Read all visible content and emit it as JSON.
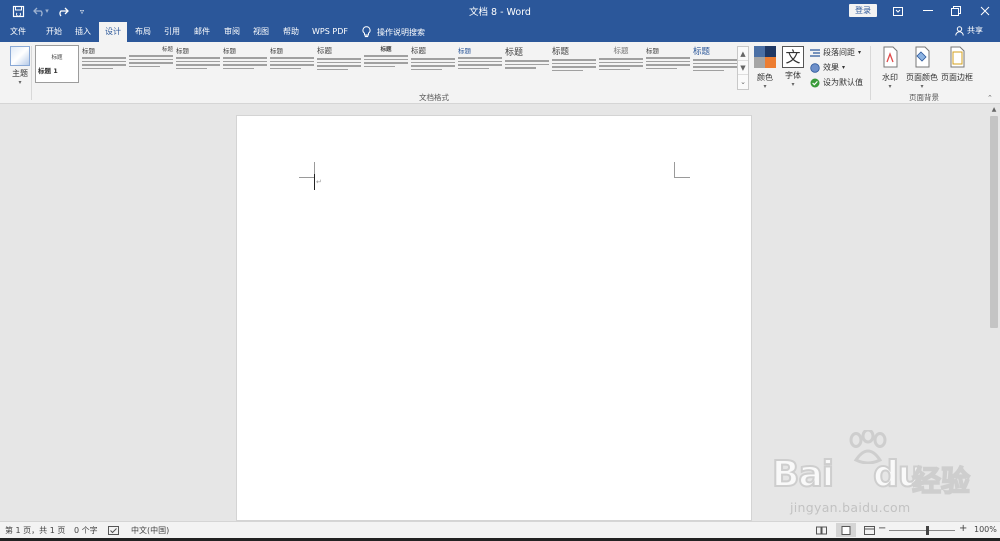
{
  "titlebar": {
    "doc_title": "文档 8  -  Word",
    "login_label": "登录"
  },
  "tabs": [
    {
      "label": "文件"
    },
    {
      "label": "开始"
    },
    {
      "label": "插入"
    },
    {
      "label": "设计",
      "active": true
    },
    {
      "label": "布局"
    },
    {
      "label": "引用"
    },
    {
      "label": "邮件"
    },
    {
      "label": "审阅"
    },
    {
      "label": "视图"
    },
    {
      "label": "帮助"
    },
    {
      "label": "WPS PDF"
    }
  ],
  "tell_me": "操作说明搜索",
  "share_label": "共享",
  "ribbon": {
    "theme_label": "主题",
    "selected_style_title": "标题 1",
    "selected_style_head": "标题",
    "gallery_heads": [
      "标题",
      "标题",
      "标题",
      "标题",
      "标题",
      "标题",
      "标题",
      "标题",
      "标题",
      "标题",
      "标题",
      "标题",
      "标题",
      "标题"
    ],
    "group_doc_format": "文档格式",
    "colors_label": "颜色",
    "fonts_label": "字体",
    "paragraph_spacing_label": "段落间距",
    "effects_label": "效果",
    "set_default_label": "设为默认值",
    "watermark_label": "水印",
    "page_color_label": "页面颜色",
    "page_borders_label": "页面边框",
    "group_page_background": "页面背景"
  },
  "statusbar": {
    "page_info": "第 1 页，共 1 页",
    "word_count": "0 个字",
    "language": "中文(中国)",
    "zoom": "100%"
  },
  "watermark": {
    "brand": "Bai",
    "brand2": "du",
    "cn": "经验",
    "url": "jingyan.baidu.com"
  },
  "colors": {
    "title_bar": "#2b579a",
    "ribbon": "#f3f3f3",
    "doc_bg": "#e6e6e6",
    "page": "#ffffff"
  }
}
